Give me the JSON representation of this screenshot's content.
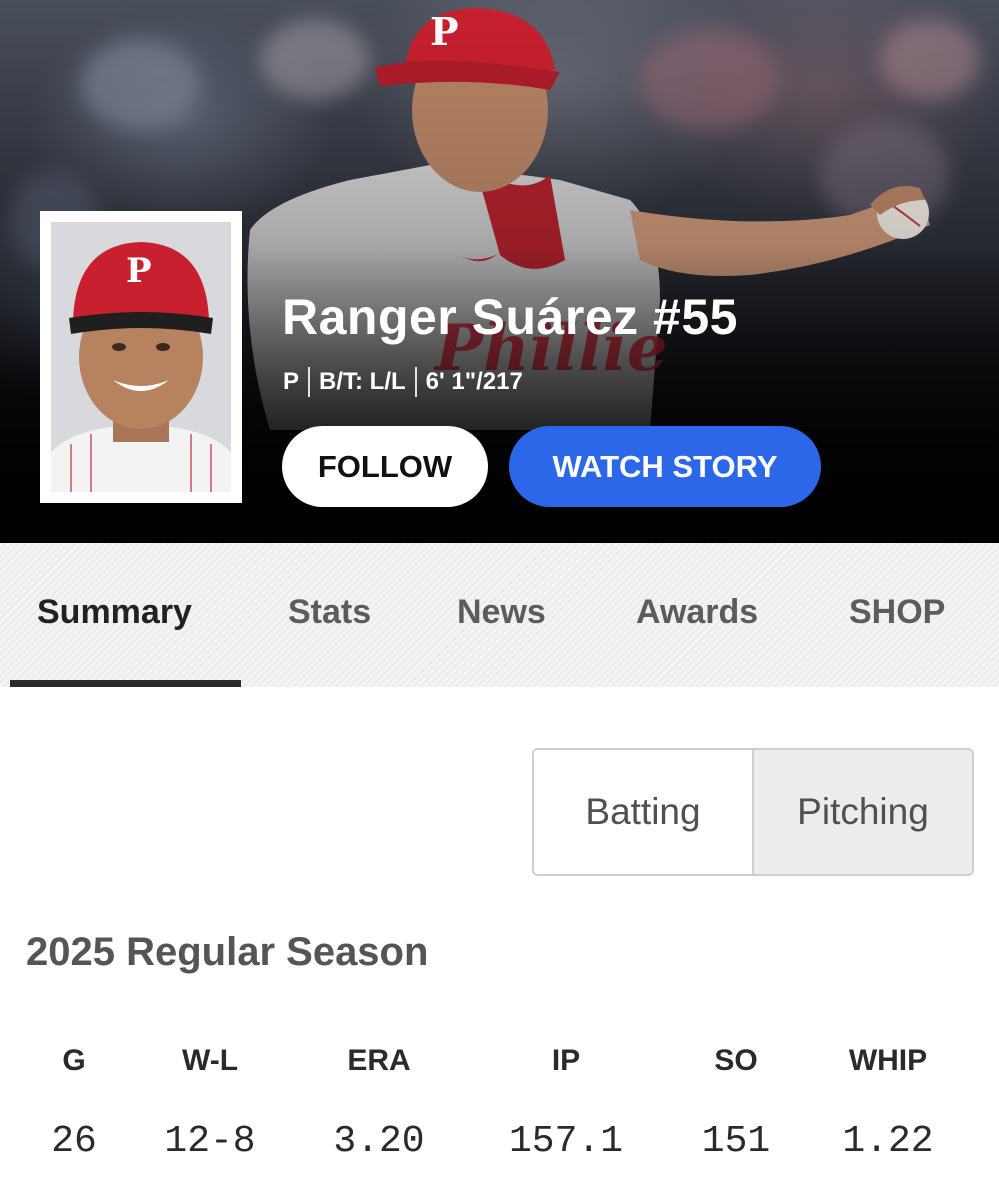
{
  "hero": {
    "player_name": "Ranger Suárez #55",
    "position": "P",
    "bats_throws": "B/T: L/L",
    "height_weight": "6' 1\"/217",
    "follow_label": "FOLLOW",
    "watch_story_label": "WATCH STORY",
    "accent_blue": "#2b67e8",
    "team_red": "#c8202f"
  },
  "tabs": [
    {
      "label": "Summary",
      "active": true
    },
    {
      "label": "Stats",
      "active": false
    },
    {
      "label": "News",
      "active": false
    },
    {
      "label": "Awards",
      "active": false
    },
    {
      "label": "SHOP",
      "active": false
    }
  ],
  "toggle": {
    "batting_label": "Batting",
    "pitching_label": "Pitching",
    "selected": "Pitching"
  },
  "season": {
    "title": "2025 Regular Season",
    "headers": [
      "G",
      "W-L",
      "ERA",
      "IP",
      "SO",
      "WHIP"
    ],
    "values": [
      "26",
      "12-8",
      "3.20",
      "157.1",
      "151",
      "1.22"
    ]
  }
}
